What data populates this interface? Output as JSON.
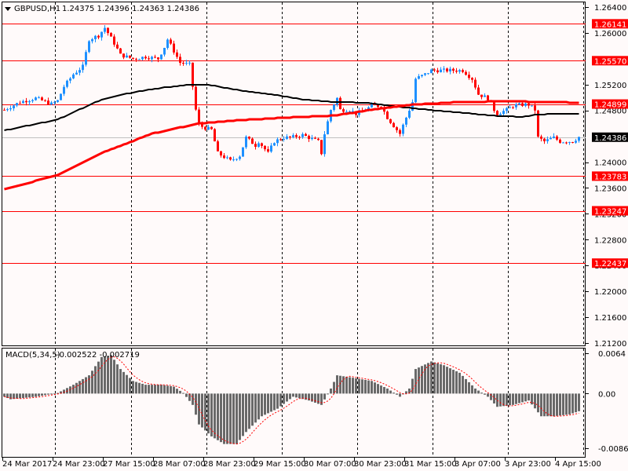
{
  "header": {
    "symbol": "GBPUSD,H1",
    "ohlc": "1.24375 1.24396 1.24363 1.24386"
  },
  "macd_header": {
    "label": "MACD(5,34,5)",
    "values": "-0.002522 -0.002719"
  },
  "colors": {
    "bg": "#fffafa",
    "bull": "#1e90ff",
    "bear": "#ff0000",
    "level": "#ff0000",
    "ma_fast": "#000000",
    "ma_slow": "#ff0000",
    "histogram": "#696969",
    "signal": "#ff0000",
    "bid_line": "#c0c0c0"
  },
  "chart_data": {
    "type": "candlestick",
    "price_axis": {
      "range": [
        1.212,
        1.264
      ],
      "ticks": [
        "1.26400",
        "1.26000",
        "1.25200",
        "1.24800",
        "1.24000",
        "1.23600",
        "1.23200",
        "1.22800",
        "1.22400",
        "1.22000",
        "1.21600",
        "1.21200"
      ]
    },
    "levels": [
      "1.26141",
      "1.25570",
      "1.24899",
      "1.23783",
      "1.23247",
      "1.22437"
    ],
    "bid": "1.24386",
    "bar_count": 184,
    "close_keyframes": [
      [
        0,
        1.2481
      ],
      [
        5,
        1.2493
      ],
      [
        10,
        1.2499
      ],
      [
        15,
        1.249
      ],
      [
        17,
        1.2495
      ],
      [
        19,
        1.2517
      ],
      [
        22,
        1.2536
      ],
      [
        25,
        1.2548
      ],
      [
        27,
        1.259
      ],
      [
        30,
        1.2596
      ],
      [
        32,
        1.2608
      ],
      [
        35,
        1.2584
      ],
      [
        37,
        1.2566
      ],
      [
        41,
        1.256
      ],
      [
        45,
        1.2563
      ],
      [
        49,
        1.256
      ],
      [
        51,
        1.2578
      ],
      [
        52,
        1.259
      ],
      [
        54,
        1.2572
      ],
      [
        56,
        1.2554
      ],
      [
        59,
        1.2551
      ],
      [
        60,
        1.2517
      ],
      [
        61,
        1.2481
      ],
      [
        62,
        1.2457
      ],
      [
        64,
        1.2453
      ],
      [
        66,
        1.245
      ],
      [
        68,
        1.2414
      ],
      [
        70,
        1.2408
      ],
      [
        72,
        1.2402
      ],
      [
        75,
        1.241
      ],
      [
        77,
        1.2438
      ],
      [
        80,
        1.2426
      ],
      [
        81,
        1.2432
      ],
      [
        84,
        1.2414
      ],
      [
        86,
        1.2432
      ],
      [
        89,
        1.2438
      ],
      [
        91,
        1.2438
      ],
      [
        95,
        1.2442
      ],
      [
        97,
        1.2438
      ],
      [
        100,
        1.2432
      ],
      [
        101,
        1.2414
      ],
      [
        102,
        1.2444
      ],
      [
        104,
        1.2481
      ],
      [
        106,
        1.2499
      ],
      [
        107,
        1.2481
      ],
      [
        110,
        1.2481
      ],
      [
        112,
        1.2475
      ],
      [
        115,
        1.2481
      ],
      [
        117,
        1.2487
      ],
      [
        120,
        1.2487
      ],
      [
        122,
        1.2469
      ],
      [
        125,
        1.245
      ],
      [
        126,
        1.2444
      ],
      [
        127,
        1.2457
      ],
      [
        130,
        1.2493
      ],
      [
        131,
        1.2529
      ],
      [
        134,
        1.2536
      ],
      [
        136,
        1.2542
      ],
      [
        139,
        1.2542
      ],
      [
        141,
        1.2542
      ],
      [
        145,
        1.2542
      ],
      [
        146,
        1.2542
      ],
      [
        149,
        1.2529
      ],
      [
        151,
        1.2505
      ],
      [
        154,
        1.2499
      ],
      [
        156,
        1.2481
      ],
      [
        157,
        1.2475
      ],
      [
        160,
        1.2481
      ],
      [
        162,
        1.2487
      ],
      [
        165,
        1.2489
      ],
      [
        167,
        1.2489
      ],
      [
        169,
        1.2481
      ],
      [
        170,
        1.2438
      ],
      [
        172,
        1.2432
      ],
      [
        175,
        1.2438
      ],
      [
        177,
        1.2432
      ],
      [
        181,
        1.2432
      ],
      [
        183,
        1.2439
      ]
    ],
    "ma_fast_keyframes": [
      [
        0,
        1.2449
      ],
      [
        17,
        1.2466
      ],
      [
        31,
        1.2497
      ],
      [
        41,
        1.2508
      ],
      [
        50,
        1.2515
      ],
      [
        59,
        1.252
      ],
      [
        66,
        1.2519
      ],
      [
        75,
        1.2511
      ],
      [
        85,
        1.2505
      ],
      [
        95,
        1.2497
      ],
      [
        105,
        1.2493
      ],
      [
        115,
        1.2492
      ],
      [
        125,
        1.2486
      ],
      [
        135,
        1.2481
      ],
      [
        145,
        1.2477
      ],
      [
        155,
        1.2472
      ],
      [
        165,
        1.247
      ],
      [
        170,
        1.2474
      ],
      [
        183,
        1.2475
      ]
    ],
    "ma_slow_keyframes": [
      [
        0,
        1.2358
      ],
      [
        17,
        1.238
      ],
      [
        32,
        1.2416
      ],
      [
        47,
        1.2444
      ],
      [
        62,
        1.246
      ],
      [
        75,
        1.2465
      ],
      [
        90,
        1.2469
      ],
      [
        105,
        1.2472
      ],
      [
        117,
        1.2481
      ],
      [
        130,
        1.2489
      ],
      [
        145,
        1.2493
      ],
      [
        160,
        1.2494
      ],
      [
        175,
        1.2493
      ],
      [
        183,
        1.2492
      ]
    ],
    "macd": {
      "axis_ticks": [
        "0.0064",
        "0.00",
        "-0.008674"
      ],
      "range": [
        -0.008674,
        0.0064
      ],
      "histogram_keyframes": [
        [
          0,
          -0.0005
        ],
        [
          2,
          -0.0009
        ],
        [
          10,
          -0.0005
        ],
        [
          17,
          0.0001
        ],
        [
          22,
          0.0014
        ],
        [
          27,
          0.0029
        ],
        [
          31,
          0.0058
        ],
        [
          34,
          0.0061
        ],
        [
          37,
          0.0039
        ],
        [
          41,
          0.002
        ],
        [
          45,
          0.0014
        ],
        [
          50,
          0.0014
        ],
        [
          54,
          0.0011
        ],
        [
          57,
          0.0001
        ],
        [
          60,
          -0.0018
        ],
        [
          62,
          -0.0049
        ],
        [
          66,
          -0.0068
        ],
        [
          70,
          -0.008
        ],
        [
          74,
          -0.008
        ],
        [
          77,
          -0.0061
        ],
        [
          82,
          -0.0036
        ],
        [
          87,
          -0.0024
        ],
        [
          92,
          -0.0005
        ],
        [
          97,
          -0.0011
        ],
        [
          101,
          -0.0018
        ],
        [
          104,
          0.0008
        ],
        [
          106,
          0.0029
        ],
        [
          110,
          0.0026
        ],
        [
          117,
          0.002
        ],
        [
          122,
          0.0008
        ],
        [
          126,
          -0.0005
        ],
        [
          129,
          0.0008
        ],
        [
          131,
          0.0039
        ],
        [
          136,
          0.0051
        ],
        [
          140,
          0.0045
        ],
        [
          145,
          0.0033
        ],
        [
          150,
          0.0008
        ],
        [
          154,
          -0.0005
        ],
        [
          157,
          -0.0021
        ],
        [
          162,
          -0.0018
        ],
        [
          167,
          -0.0011
        ],
        [
          171,
          -0.0036
        ],
        [
          175,
          -0.0036
        ],
        [
          180,
          -0.0033
        ],
        [
          183,
          -0.0028
        ]
      ]
    },
    "time_labels": [
      "24 Mar 2017",
      "24 Mar 23:00",
      "27 Mar 15:00",
      "28 Mar 07:00",
      "28 Mar 23:00",
      "29 Mar 15:00",
      "30 Mar 07:00",
      "30 Mar 23:00",
      "31 Mar 15:00",
      "3 Apr 07:00",
      "3 Apr 23:00",
      "4 Apr 15:00"
    ]
  }
}
